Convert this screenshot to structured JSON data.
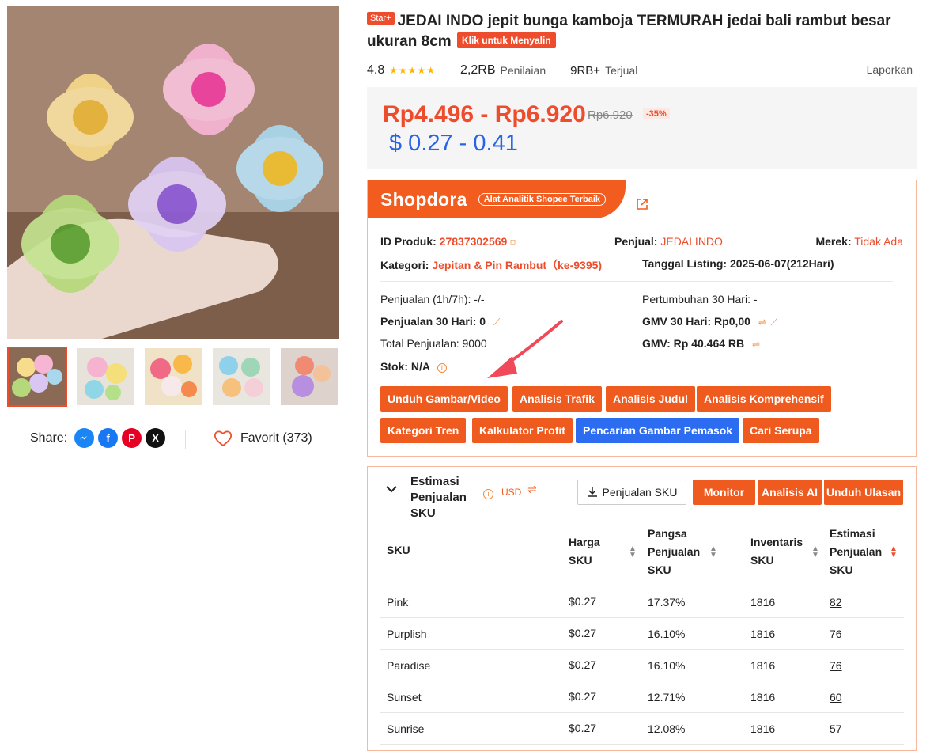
{
  "product": {
    "star_badge": "Star+",
    "title": "JEDAI INDO jepit bunga kamboja TERMURAH jedai bali rambut besar ukuran 8cm",
    "copy_label": "Klik untuk Menyalin",
    "rating": "4.8",
    "stars": "★★★★★",
    "reviews_count": "2,2RB",
    "reviews_label": "Penilaian",
    "sold_count": "9RB+",
    "sold_label": "Terjual",
    "report_label": "Laporkan",
    "price_range": "Rp4.496 - Rp6.920",
    "original_price": "Rp6.920",
    "discount": "-35%",
    "usd_price": "$ 0.27 - 0.41"
  },
  "gallery": {
    "share_label": "Share:",
    "favorite_label": "Favorit (373)"
  },
  "shopdora": {
    "logo": "Shopdora",
    "tagline": "Alat Analitik Shopee Terbaik",
    "product_id_label": "ID Produk:",
    "product_id": "27837302569",
    "seller_label": "Penjual:",
    "seller": "JEDAI INDO",
    "brand_label": "Merek:",
    "brand": "Tidak Ada",
    "category_label": "Kategori:",
    "category": "Jepitan & Pin Rambut（ke-9395)",
    "listing_label": "Tanggal Listing:",
    "listing": "2025-06-07(212Hari)",
    "sales_1h7h": "Penjualan (1h/7h): -/-",
    "growth_30": "Pertumbuhan 30 Hari: -",
    "sales_30": "Penjualan 30 Hari: 0",
    "gmv_30": "GMV 30 Hari: Rp0,00",
    "total_sales": "Total Penjualan: 9000",
    "gmv": "GMV: Rp 40.464 RB",
    "stock": "Stok: N/A",
    "buttons": {
      "download": "Unduh Gambar/Video",
      "traffic": "Analisis Trafik",
      "title_analysis": "Analisis Judul",
      "comprehensive": "Analisis Komprehensif",
      "trend": "Kategori Tren",
      "profit": "Kalkulator Profit",
      "supplier": "Pencarian Gambar Pemasok",
      "similar": "Cari Serupa"
    }
  },
  "sku": {
    "title": "Estimasi Penjualan SKU",
    "currency": "USD",
    "sales_button": "Penjualan SKU",
    "monitor": "Monitor",
    "ai": "Analisis AI",
    "reviews": "Unduh Ulasan",
    "headers": {
      "sku": "SKU",
      "price": "Harga SKU",
      "share": "Pangsa Penjualan SKU",
      "inventory": "Inventaris SKU",
      "estimate": "Estimasi Penjualan SKU"
    },
    "rows": [
      {
        "name": "Pink",
        "price": "$0.27",
        "share": "17.37%",
        "inv": "1816",
        "est": "82"
      },
      {
        "name": "Purplish",
        "price": "$0.27",
        "share": "16.10%",
        "inv": "1816",
        "est": "76"
      },
      {
        "name": "Paradise",
        "price": "$0.27",
        "share": "16.10%",
        "inv": "1816",
        "est": "76"
      },
      {
        "name": "Sunset",
        "price": "$0.27",
        "share": "12.71%",
        "inv": "1816",
        "est": "60"
      },
      {
        "name": "Sunrise",
        "price": "$0.27",
        "share": "12.08%",
        "inv": "1816",
        "est": "57"
      }
    ]
  }
}
